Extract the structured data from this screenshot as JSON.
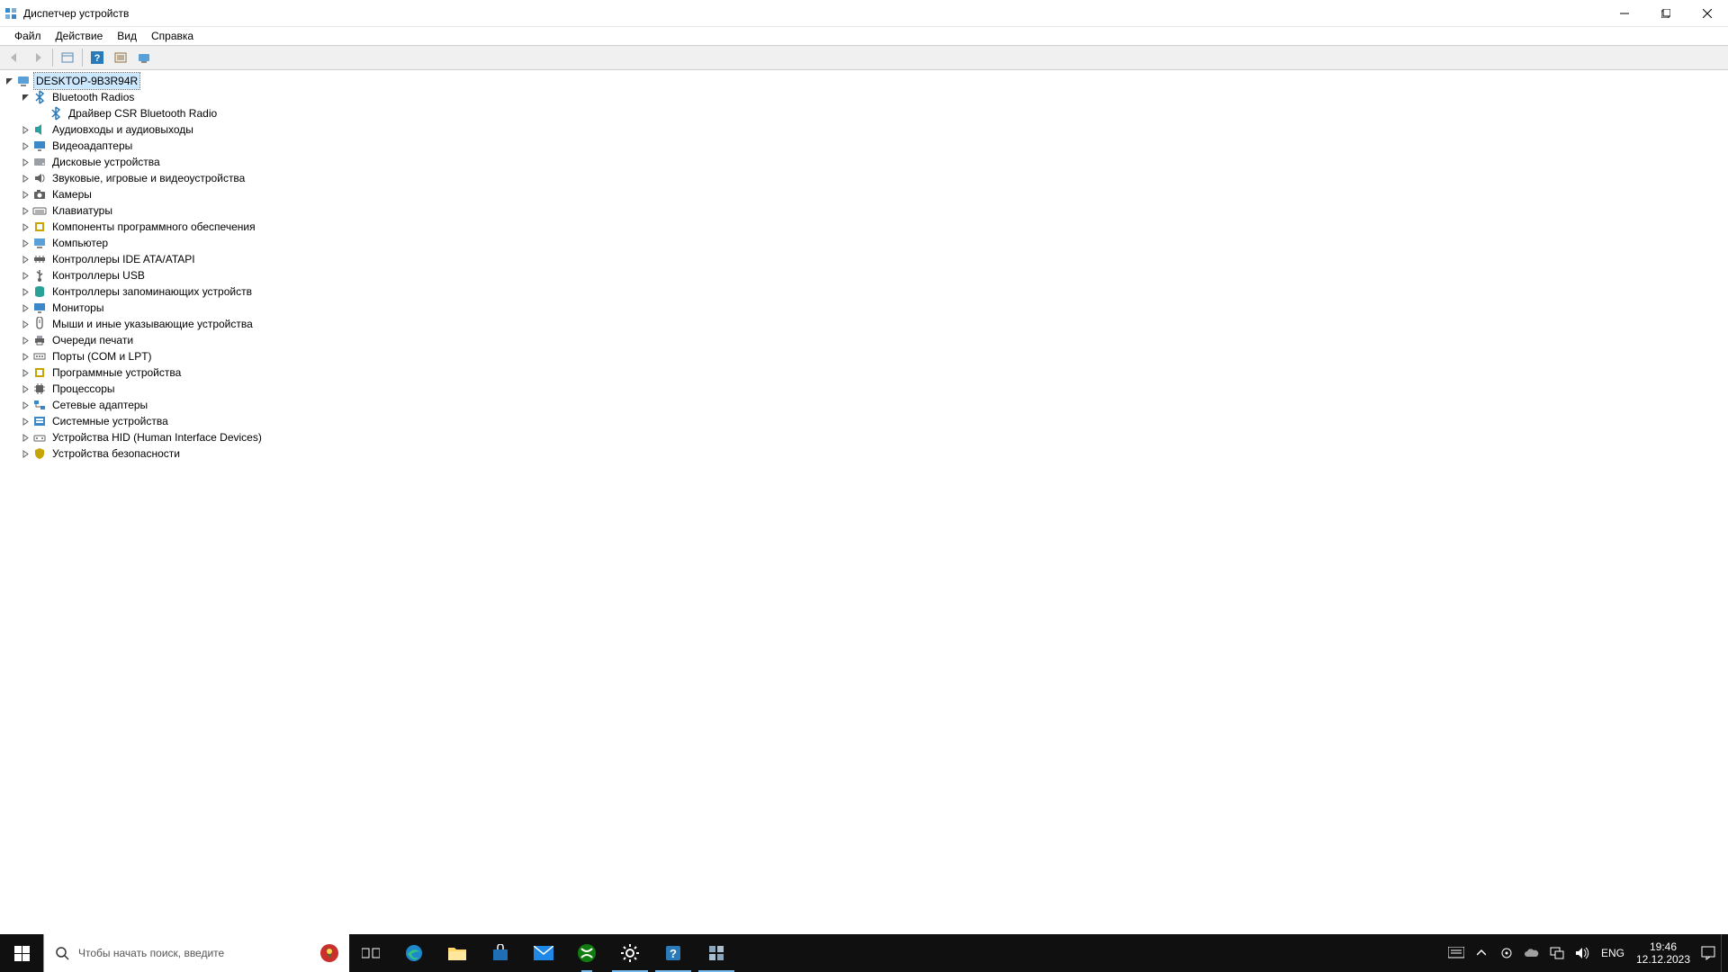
{
  "window": {
    "title": "Диспетчер устройств"
  },
  "menu": {
    "file": "Файл",
    "action": "Действие",
    "view": "Вид",
    "help": "Справка"
  },
  "tree": {
    "root": "DESKTOP-9B3R94R",
    "categories": [
      {
        "label": "Bluetooth Radios",
        "icon": "bluetooth",
        "expanded": true,
        "children": [
          {
            "label": "Драйвер CSR Bluetooth Radio",
            "icon": "bluetooth"
          }
        ]
      },
      {
        "label": "Аудиовходы и аудиовыходы",
        "icon": "audio"
      },
      {
        "label": "Видеоадаптеры",
        "icon": "display"
      },
      {
        "label": "Дисковые устройства",
        "icon": "disk"
      },
      {
        "label": "Звуковые, игровые и видеоустройства",
        "icon": "sound"
      },
      {
        "label": "Камеры",
        "icon": "camera"
      },
      {
        "label": "Клавиатуры",
        "icon": "keyboard"
      },
      {
        "label": "Компоненты программного обеспечения",
        "icon": "software"
      },
      {
        "label": "Компьютер",
        "icon": "computer"
      },
      {
        "label": "Контроллеры IDE ATA/ATAPI",
        "icon": "ide"
      },
      {
        "label": "Контроллеры USB",
        "icon": "usb"
      },
      {
        "label": "Контроллеры запоминающих устройств",
        "icon": "storage"
      },
      {
        "label": "Мониторы",
        "icon": "monitor"
      },
      {
        "label": "Мыши и иные указывающие устройства",
        "icon": "mouse"
      },
      {
        "label": "Очереди печати",
        "icon": "printer"
      },
      {
        "label": "Порты (COM и LPT)",
        "icon": "port"
      },
      {
        "label": "Программные устройства",
        "icon": "software"
      },
      {
        "label": "Процессоры",
        "icon": "cpu"
      },
      {
        "label": "Сетевые адаптеры",
        "icon": "network"
      },
      {
        "label": "Системные устройства",
        "icon": "system"
      },
      {
        "label": "Устройства HID (Human Interface Devices)",
        "icon": "hid"
      },
      {
        "label": "Устройства безопасности",
        "icon": "security"
      }
    ]
  },
  "taskbar": {
    "search_placeholder": "Чтобы начать поиск, введите",
    "lang": "ENG",
    "time": "19:46",
    "date": "12.12.2023"
  }
}
